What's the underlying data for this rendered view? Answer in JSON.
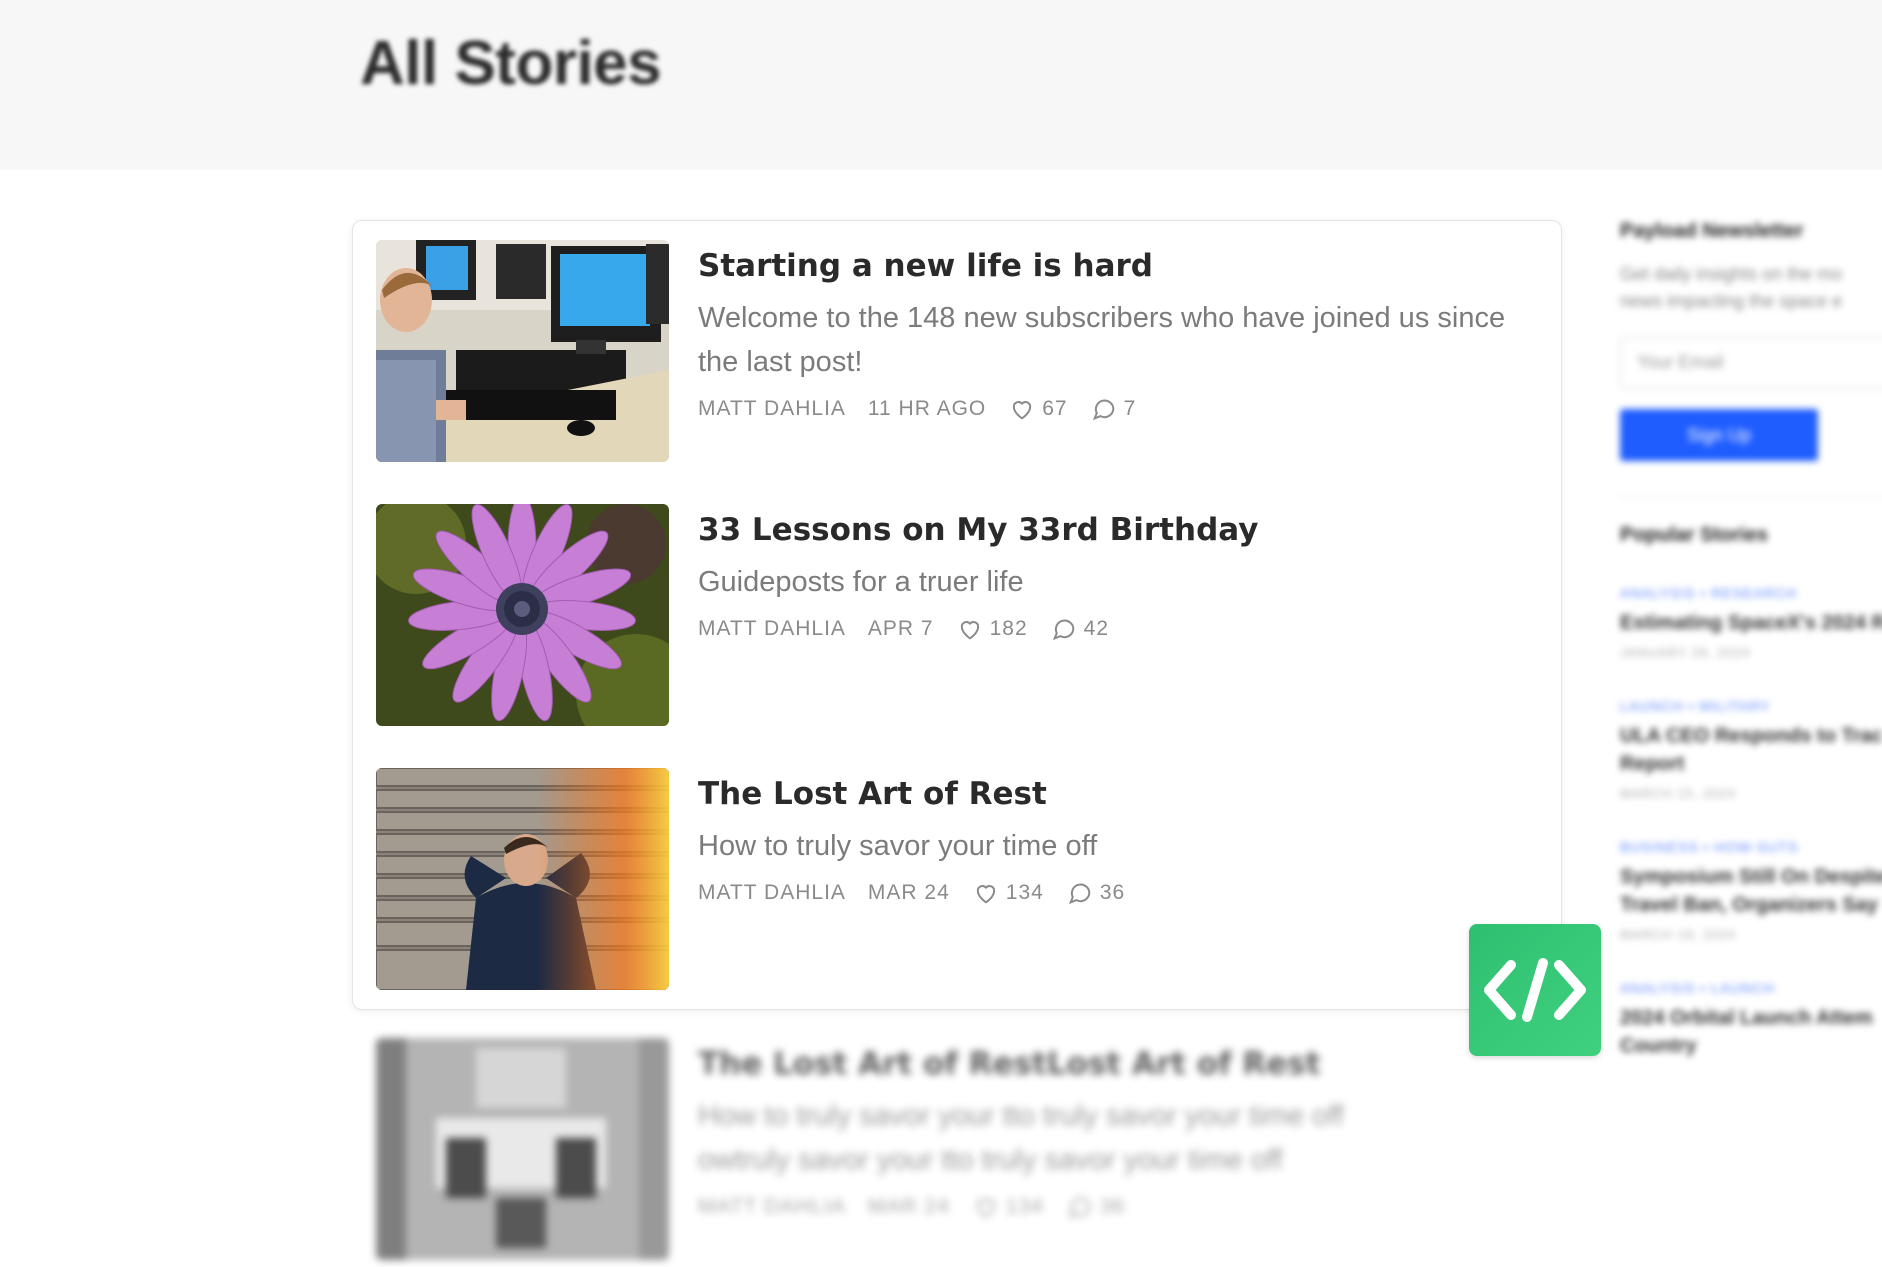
{
  "page": {
    "title": "All Stories"
  },
  "stories": [
    {
      "title": "Starting a new life is hard",
      "subtitle": "Welcome to the 148 new subscribers who have joined us since the last post!",
      "author": "MATT DAHLIA",
      "time": "11 HR AGO",
      "likes": "67",
      "comments": "7",
      "image_icon": "computer-lab-photo"
    },
    {
      "title": "33 Lessons on My 33rd Birthday",
      "subtitle": "Guideposts for a truer life",
      "author": "MATT DAHLIA",
      "time": "APR 7",
      "likes": "182",
      "comments": "42",
      "image_icon": "pink-daisy-photo"
    },
    {
      "title": "The Lost Art of Rest",
      "subtitle": "How to truly savor your time off",
      "author": "MATT DAHLIA",
      "time": "MAR 24",
      "likes": "134",
      "comments": "36",
      "image_icon": "man-resting-on-steps-photo"
    }
  ],
  "ghost_story": {
    "title": "The Lost Art of RestLost Art of Rest",
    "subtitle_line1": "How to truly savor your tto truly savor your time off",
    "subtitle_line2": "owtruly savor your tto truly savor your time off",
    "author": "MATT DAHLIA",
    "time": "MAR 24",
    "likes": "134",
    "comments": "36"
  },
  "sidebar": {
    "newsletter_heading": "Payload Newsletter",
    "newsletter_text_line1": "Get daily insights on the mo",
    "newsletter_text_line2": "news impacting the space e",
    "email_placeholder": "Your Email",
    "signup_label": "Sign Up",
    "popular_heading": "Popular Stories",
    "popular": [
      {
        "tag": "ANALYSIS • RESEARCH",
        "title_line1": "Estimating SpaceX's 2024 R",
        "title_line2": "",
        "date": "JANUARY 29, 2024"
      },
      {
        "tag": "LAUNCH • MILITARY",
        "title_line1": "ULA CEO Responds to Trac",
        "title_line2": "Report",
        "date": "MARCH 15, 2024"
      },
      {
        "tag": "BUSINESS • HOW-SUTS",
        "title_line1": "Symposium Still On Despite",
        "title_line2": "Travel Ban, Organizers Say",
        "date": "MARCH 19, 2024"
      },
      {
        "tag": "ANALYSIS • LAUNCH",
        "title_line1": "2024 Orbital Launch Attem",
        "title_line2": "Country",
        "date": ""
      }
    ]
  },
  "colors": {
    "accent_blue": "#1f5dff",
    "badge_green": "#34c776",
    "muted_text": "#7b7b7b"
  },
  "badge_icon": "code-brackets-icon"
}
